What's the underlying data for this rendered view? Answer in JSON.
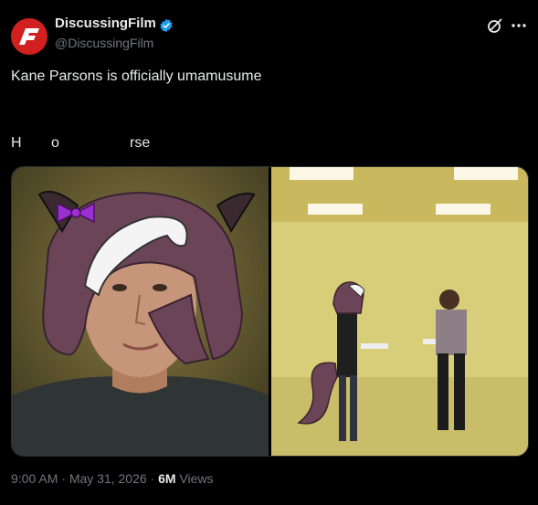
{
  "author": {
    "name": "DiscussingFilm",
    "handle": "@DiscussingFilm",
    "avatar_text": "DF",
    "brand_color": "#d21f1f",
    "verified_color": "#1d9bf0"
  },
  "icons": [
    "grok-icon",
    "more-icon",
    "verified-icon"
  ],
  "tweet": {
    "text": "Kane Parsons is officially umamusume",
    "line2_parts": [
      "H",
      "o",
      "rse"
    ]
  },
  "media": {
    "count": 2
  },
  "meta": {
    "time": "9:00 AM",
    "date": "May 31, 2026",
    "views_count": "6M",
    "views_label": "Views"
  }
}
